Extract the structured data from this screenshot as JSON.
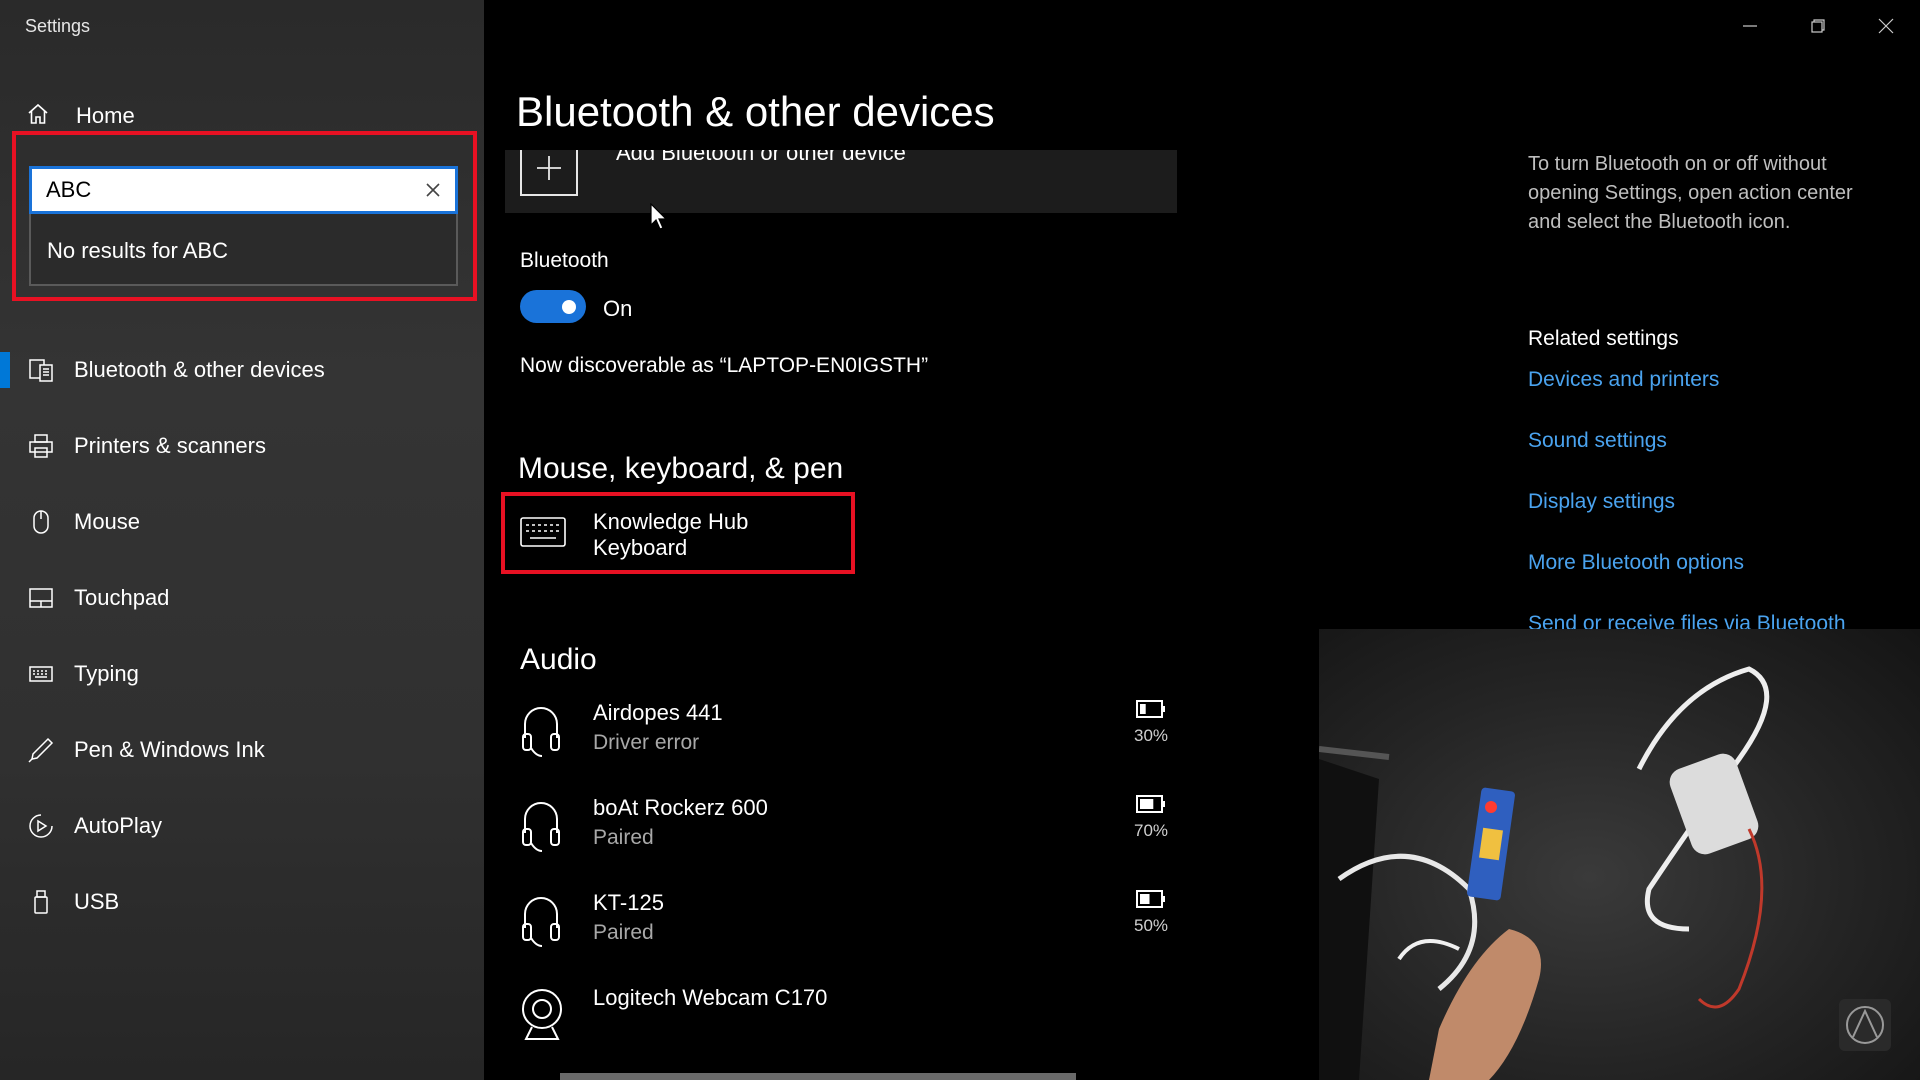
{
  "window": {
    "title": "Settings"
  },
  "sidebar": {
    "home_label": "Home",
    "search": {
      "value": "ABC",
      "no_results": "No results for ABC"
    },
    "items": [
      {
        "label": "Bluetooth & other devices",
        "icon": "bluetooth-devices-icon",
        "selected": true
      },
      {
        "label": "Printers & scanners",
        "icon": "printer-icon"
      },
      {
        "label": "Mouse",
        "icon": "mouse-icon"
      },
      {
        "label": "Touchpad",
        "icon": "touchpad-icon"
      },
      {
        "label": "Typing",
        "icon": "keyboard-icon"
      },
      {
        "label": "Pen & Windows Ink",
        "icon": "pen-icon"
      },
      {
        "label": "AutoPlay",
        "icon": "autoplay-icon"
      },
      {
        "label": "USB",
        "icon": "usb-icon"
      }
    ]
  },
  "main": {
    "title": "Bluetooth & other devices",
    "add_device_label": "Add Bluetooth or other device",
    "bluetooth": {
      "label": "Bluetooth",
      "state": "On",
      "discoverable": "Now discoverable as “LAPTOP-EN0IGSTH”"
    },
    "mouse_keyboard_pen": {
      "heading": "Mouse, keyboard, & pen",
      "devices": [
        {
          "name": "Knowledge Hub Keyboard"
        }
      ]
    },
    "audio": {
      "heading": "Audio",
      "devices": [
        {
          "name": "Airdopes 441",
          "status": "Driver error",
          "battery": "30%",
          "battery_level": 0.3
        },
        {
          "name": "boAt Rockerz 600",
          "status": "Paired",
          "battery": "70%",
          "battery_level": 0.7
        },
        {
          "name": "KT-125",
          "status": "Paired",
          "battery": "50%",
          "battery_level": 0.5
        },
        {
          "name": "Logitech Webcam C170",
          "status": ""
        }
      ]
    }
  },
  "right_panel": {
    "info": "To turn Bluetooth on or off without opening Settings, open action center and select the Bluetooth icon.",
    "related_title": "Related settings",
    "links": [
      "Devices and printers",
      "Sound settings",
      "Display settings",
      "More Bluetooth options",
      "Send or receive files via Bluetooth"
    ]
  },
  "colors": {
    "accent": "#0078d7",
    "link": "#4aa3ef",
    "highlight": "#e81123"
  }
}
